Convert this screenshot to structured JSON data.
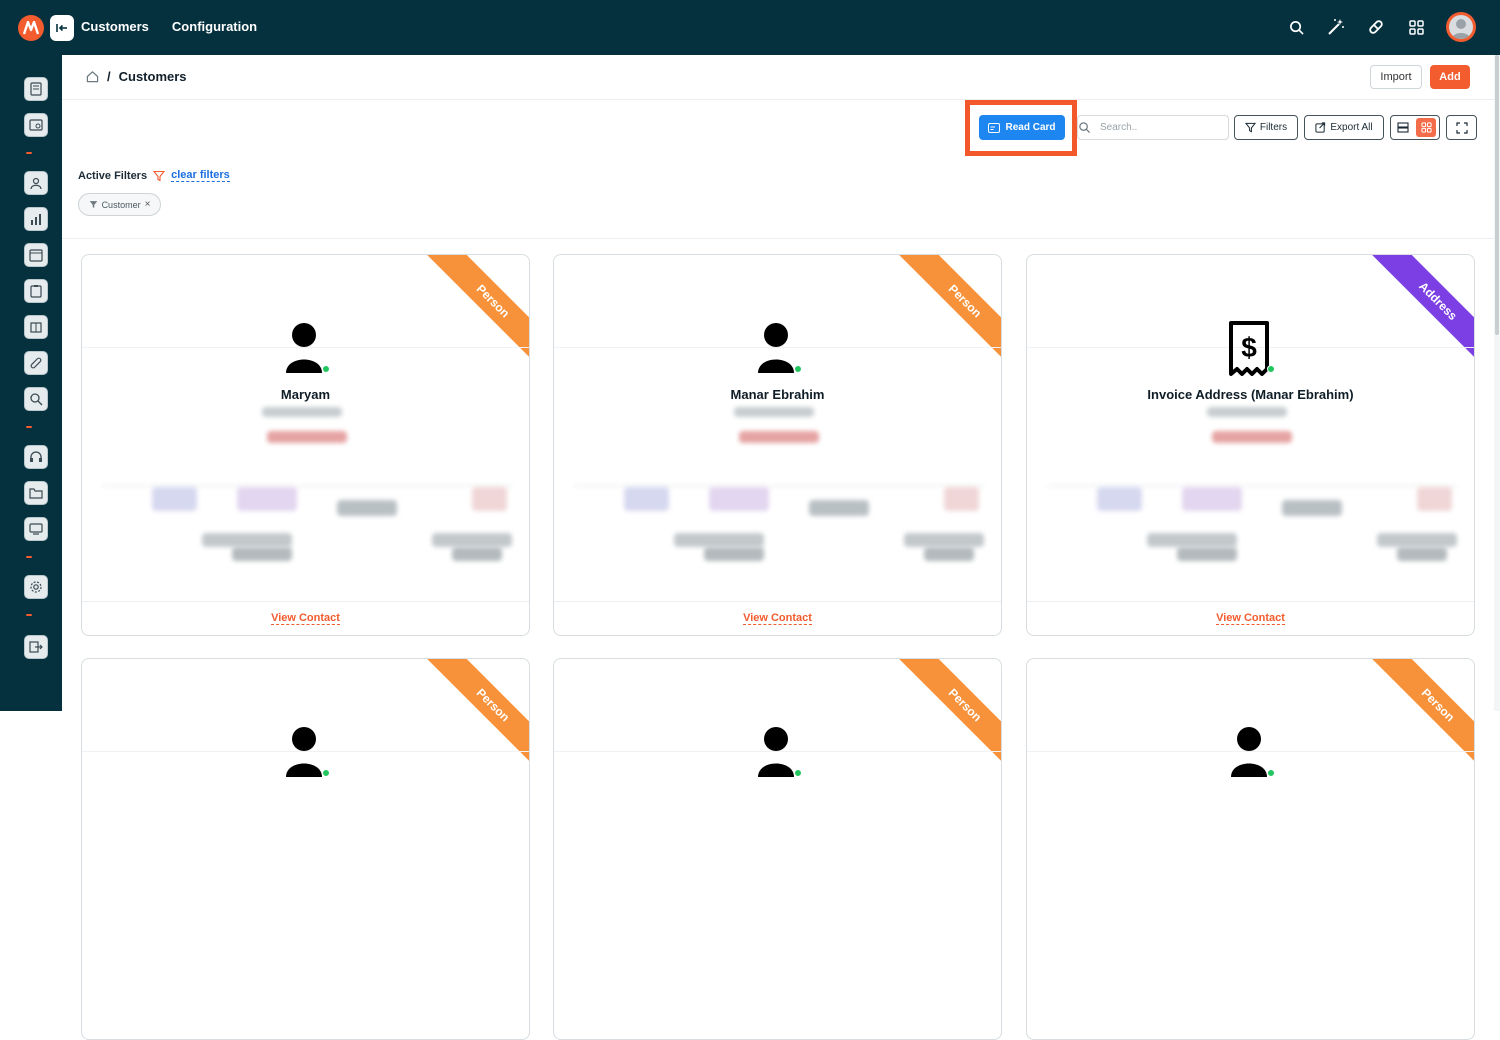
{
  "topbar": {
    "nav": [
      "Customers",
      "Configuration"
    ]
  },
  "header": {
    "breadcrumb_current": "Customers",
    "breadcrumb_sep": "/",
    "import_label": "Import",
    "add_label": "Add"
  },
  "toolbar": {
    "read_card_label": "Read Card",
    "search_placeholder": "Search..",
    "filters_label": "Filters",
    "export_label": "Export All"
  },
  "filters": {
    "active_label": "Active Filters",
    "clear_label": "clear filters",
    "chips": [
      "Customer"
    ]
  },
  "cards": [
    {
      "name": "Maryam",
      "ribbon": "Person",
      "ribbon_color": "#f7923a",
      "icon": "person-icon",
      "link": "View Contact"
    },
    {
      "name": "Manar Ebrahim",
      "ribbon": "Person",
      "ribbon_color": "#f7923a",
      "icon": "person-icon",
      "link": "View Contact"
    },
    {
      "name": "Invoice Address (Manar Ebrahim)",
      "ribbon": "Address",
      "ribbon_color": "#7b3fe4",
      "icon": "invoice-receipt-icon",
      "link": "View Contact"
    },
    {
      "name": "",
      "ribbon": "Person",
      "ribbon_color": "#f7923a",
      "icon": "person-icon",
      "link": ""
    },
    {
      "name": "",
      "ribbon": "Person",
      "ribbon_color": "#f7923a",
      "icon": "person-icon",
      "link": ""
    },
    {
      "name": "",
      "ribbon": "Person",
      "ribbon_color": "#f7923a",
      "icon": "person-icon",
      "link": ""
    }
  ],
  "colors": {
    "brand_dark": "#05313f",
    "accent": "#f25c2e",
    "primary_blue": "#1d86f0",
    "person_ribbon": "#f7923a",
    "address_ribbon": "#7b3fe4",
    "online_dot": "#22c55e"
  }
}
